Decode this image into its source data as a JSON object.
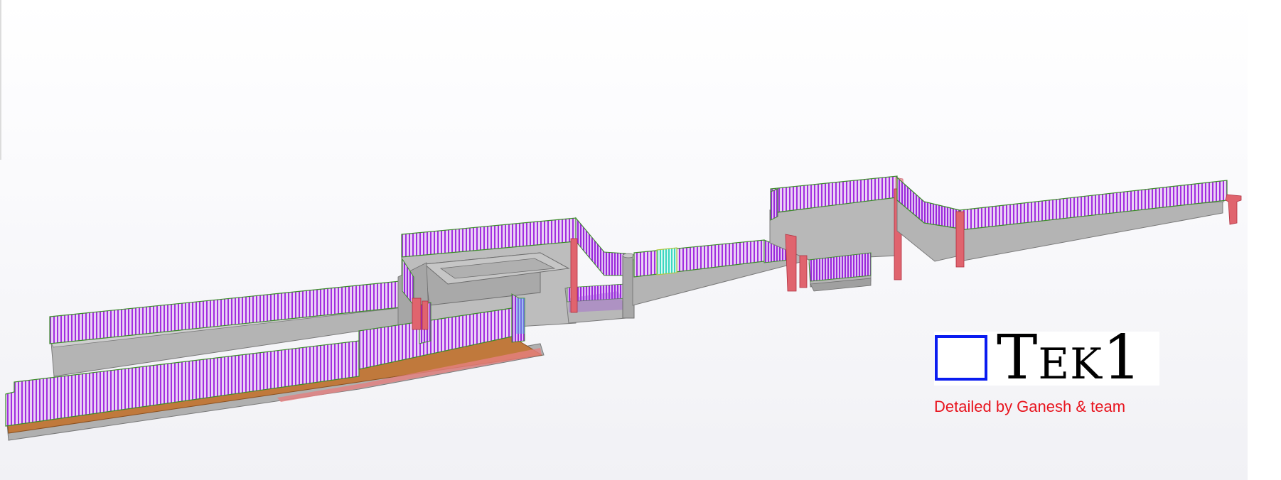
{
  "brand": {
    "name_first": "T",
    "name_rest": "EK",
    "name_digit": "1",
    "tagline": "Detailed by Ganesh & team"
  },
  "model": {
    "label": "3D railing / retaining wall model",
    "colors": {
      "concrete": "#b4b4b4",
      "railing": "#a22ee0",
      "posts": "#e0646e",
      "deck": "#c0793c",
      "edge": "#3c8c2a",
      "highlight": "#46e0c8"
    }
  },
  "colors": {
    "logo_box": "#0a1cf0",
    "credit": "#e8141e"
  }
}
